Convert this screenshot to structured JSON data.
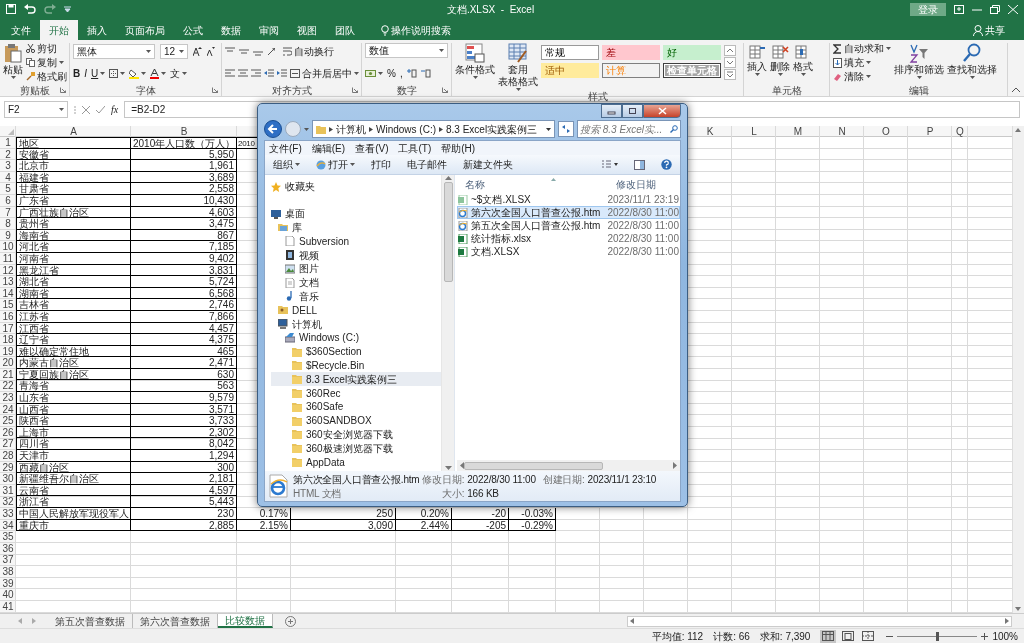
{
  "title_bar": {
    "title": "文档.XLSX  -  Excel",
    "sign_in": "登录"
  },
  "ribbon_tabs": [
    {
      "label": "文件",
      "selected": false
    },
    {
      "label": "开始",
      "selected": true
    },
    {
      "label": "插入",
      "selected": false
    },
    {
      "label": "页面布局",
      "selected": false
    },
    {
      "label": "公式",
      "selected": false
    },
    {
      "label": "数据",
      "selected": false
    },
    {
      "label": "审阅",
      "selected": false
    },
    {
      "label": "视图",
      "selected": false
    },
    {
      "label": "团队",
      "selected": false
    }
  ],
  "tell_me": "操作说明搜索",
  "share": "共享",
  "clipboard": {
    "paste": "粘贴",
    "cut": "剪切",
    "copy": "复制",
    "format_painter": "格式刷",
    "label": "剪贴板"
  },
  "font": {
    "name": "黑体",
    "size": "12",
    "bold": "B",
    "italic": "I",
    "underline": "U",
    "phonetic": "文",
    "label": "字体"
  },
  "alignment": {
    "wrap_text": "自动换行",
    "merge": "合并后居中",
    "label": "对齐方式"
  },
  "number": {
    "format": "数值",
    "percent": "%",
    "comma": ",",
    "label": "数字"
  },
  "styles": {
    "conditional": "条件格式",
    "table_format": [
      "套用",
      "表格格式"
    ],
    "cell_styles": [
      {
        "label": "常规",
        "kind": "normal"
      },
      {
        "label": "差",
        "kind": "bad"
      },
      {
        "label": "好",
        "kind": "good"
      },
      {
        "label": "适中",
        "kind": "neutral"
      },
      {
        "label": "计算",
        "kind": "calculation"
      },
      {
        "label": "检查单元格",
        "kind": "check"
      }
    ],
    "label": "样式"
  },
  "cells": {
    "insert": "插入",
    "delete": "删除",
    "format": "格式",
    "label": "单元格"
  },
  "editing": {
    "autosum": "自动求和",
    "fill": "填充",
    "clear": "清除",
    "sort": "排序和筛选",
    "find": "查找和选择",
    "label": "编辑"
  },
  "formula_bar": {
    "name_box": "F2",
    "insert_function": "fx",
    "formula": "=B2-D2"
  },
  "sheet": {
    "columns": [
      "A",
      "B",
      null,
      null,
      null,
      null,
      null,
      null,
      null,
      null,
      "K",
      "L",
      "M",
      "N",
      "O",
      "P",
      "Q"
    ],
    "rows": [
      {
        "n": "1",
        "cells": [
          "地区",
          "2010年人口数（万人）",
          "2010"
        ]
      },
      {
        "n": "2",
        "cells": [
          "安徽省",
          "5,950"
        ]
      },
      {
        "n": "3",
        "cells": [
          "北京市",
          "1,961"
        ]
      },
      {
        "n": "4",
        "cells": [
          "福建省",
          "3,689"
        ]
      },
      {
        "n": "5",
        "cells": [
          "甘肃省",
          "2,558"
        ]
      },
      {
        "n": "6",
        "cells": [
          "广东省",
          "10,430"
        ]
      },
      {
        "n": "7",
        "cells": [
          "广西壮族自治区",
          "4,603"
        ]
      },
      {
        "n": "8",
        "cells": [
          "贵州省",
          "3,475"
        ]
      },
      {
        "n": "9",
        "cells": [
          "海南省",
          "867"
        ]
      },
      {
        "n": "10",
        "cells": [
          "河北省",
          "7,185"
        ]
      },
      {
        "n": "11",
        "cells": [
          "河南省",
          "9,402"
        ]
      },
      {
        "n": "12",
        "cells": [
          "黑龙江省",
          "3,831"
        ]
      },
      {
        "n": "13",
        "cells": [
          "湖北省",
          "5,724"
        ]
      },
      {
        "n": "14",
        "cells": [
          "湖南省",
          "6,568"
        ]
      },
      {
        "n": "15",
        "cells": [
          "吉林省",
          "2,746"
        ]
      },
      {
        "n": "16",
        "cells": [
          "江苏省",
          "7,866"
        ]
      },
      {
        "n": "17",
        "cells": [
          "江西省",
          "4,457"
        ]
      },
      {
        "n": "18",
        "cells": [
          "辽宁省",
          "4,375"
        ]
      },
      {
        "n": "19",
        "cells": [
          "难以确定常住地",
          "465"
        ]
      },
      {
        "n": "20",
        "cells": [
          "内蒙古自治区",
          "2,471"
        ]
      },
      {
        "n": "21",
        "cells": [
          "宁夏回族自治区",
          "630"
        ]
      },
      {
        "n": "22",
        "cells": [
          "青海省",
          "563"
        ]
      },
      {
        "n": "23",
        "cells": [
          "山东省",
          "9,579"
        ]
      },
      {
        "n": "24",
        "cells": [
          "山西省",
          "3,571"
        ]
      },
      {
        "n": "25",
        "cells": [
          "陕西省",
          "3,733"
        ]
      },
      {
        "n": "26",
        "cells": [
          "上海市",
          "2,302"
        ]
      },
      {
        "n": "27",
        "cells": [
          "四川省",
          "8,042"
        ]
      },
      {
        "n": "28",
        "cells": [
          "天津市",
          "1,294"
        ]
      },
      {
        "n": "29",
        "cells": [
          "西藏自治区",
          "300"
        ]
      },
      {
        "n": "30",
        "cells": [
          "新疆维吾尔自治区",
          "2,181"
        ]
      },
      {
        "n": "31",
        "cells": [
          "云南省",
          "4,597"
        ]
      },
      {
        "n": "32",
        "cells": [
          "浙江省",
          "5,443"
        ]
      },
      {
        "n": "33",
        "cells": [
          "中国人民解放军现役军人",
          "230",
          "0.17%",
          "250",
          "0.20%",
          "-20",
          "-0.03%"
        ]
      },
      {
        "n": "34",
        "cells": [
          "重庆市",
          "2,885",
          "2.15%",
          "3,090",
          "2.44%",
          "-205",
          "-0.29%"
        ]
      },
      {
        "n": "35"
      },
      {
        "n": "36"
      },
      {
        "n": "37"
      },
      {
        "n": "38"
      },
      {
        "n": "39"
      },
      {
        "n": "40"
      },
      {
        "n": "41"
      }
    ]
  },
  "sheet_tabs": [
    {
      "label": "第五次普查数据",
      "selected": false
    },
    {
      "label": "第六次普查数据",
      "selected": false
    },
    {
      "label": "比较数据",
      "selected": true
    }
  ],
  "status_bar": {
    "average": "平均值: 112",
    "count": "计数: 66",
    "sum": "求和: 7,390",
    "views": [
      {
        "kind": "normal",
        "selected": true
      },
      {
        "kind": "page_layout",
        "selected": false
      },
      {
        "kind": "page_break",
        "selected": false
      }
    ],
    "zoom": {
      "level": 0.5
    },
    "zoom_label": "100%"
  },
  "dialog": {
    "address": [
      "计算机",
      "Windows (C:)",
      "8.3 Excel实践案例三"
    ],
    "search_placeholder": "搜索 8.3 Excel实...",
    "menu": [
      "文件(F)",
      "编辑(E)",
      "查看(V)",
      "工具(T)",
      "帮助(H)"
    ],
    "toolbar": [
      "组织",
      "打开",
      "打印",
      "电子邮件",
      "新建文件夹"
    ],
    "nav": [
      {
        "label": "收藏夹",
        "kind": "favorites",
        "selected": false
      },
      {
        "label": "桌面",
        "kind": "desktop",
        "selected": false,
        "children": [
          {
            "label": "库",
            "kind": "library",
            "selected": false,
            "children": [
              {
                "label": "Subversion",
                "kind": "file",
                "selected": false
              },
              {
                "label": "视频",
                "kind": "video",
                "selected": false
              },
              {
                "label": "图片",
                "kind": "picture",
                "selected": false
              },
              {
                "label": "文档",
                "kind": "document",
                "selected": false
              },
              {
                "label": "音乐",
                "kind": "music",
                "selected": false
              }
            ]
          },
          {
            "label": "DELL",
            "kind": "user",
            "selected": false
          },
          {
            "label": "计算机",
            "kind": "computer",
            "selected": false,
            "children": [
              {
                "label": "Windows (C:)",
                "kind": "drive",
                "selected": false,
                "children": [
                  {
                    "label": "$360Section",
                    "kind": "folder",
                    "selected": false
                  },
                  {
                    "label": "$Recycle.Bin",
                    "kind": "folder",
                    "selected": false
                  },
                  {
                    "label": "8.3 Excel实践案例三",
                    "kind": "folder",
                    "selected": true
                  },
                  {
                    "label": "360Rec",
                    "kind": "folder",
                    "selected": false
                  },
                  {
                    "label": "360Safe",
                    "kind": "folder",
                    "selected": false
                  },
                  {
                    "label": "360SANDBOX",
                    "kind": "folder",
                    "selected": false
                  },
                  {
                    "label": "360安全浏览器下载",
                    "kind": "folder",
                    "selected": false
                  },
                  {
                    "label": "360极速浏览器下载",
                    "kind": "folder",
                    "selected": false
                  },
                  {
                    "label": "AppData",
                    "kind": "folder",
                    "selected": false
                  }
                ]
              }
            ]
          }
        ]
      }
    ],
    "file_columns": [
      "名称",
      "修改日期"
    ],
    "files": [
      {
        "name": "~$文档.XLSX",
        "modified": "2023/11/1 23:19",
        "kind": "excel_temp",
        "selected": false
      },
      {
        "name": "第六次全国人口普查公报.htm",
        "modified": "2022/8/30 11:00",
        "kind": "html",
        "selected": true
      },
      {
        "name": "第五次全国人口普查公报.htm",
        "modified": "2022/8/30 11:00",
        "kind": "html",
        "selected": false
      },
      {
        "name": "统计指标.xlsx",
        "modified": "2022/8/30 11:00",
        "kind": "excel",
        "selected": false
      },
      {
        "name": "文档.XLSX",
        "modified": "2022/8/30 11:00",
        "kind": "excel",
        "selected": false
      }
    ],
    "details": {
      "name": "第六次全国人口普查公报.htm",
      "modified_label": "修改日期:",
      "modified": "2022/8/30 11:00",
      "created_label": "创建日期:",
      "created": "2023/11/1 23:10",
      "type": "HTML 文档",
      "size_label": "大小:",
      "size": "166 KB"
    }
  }
}
